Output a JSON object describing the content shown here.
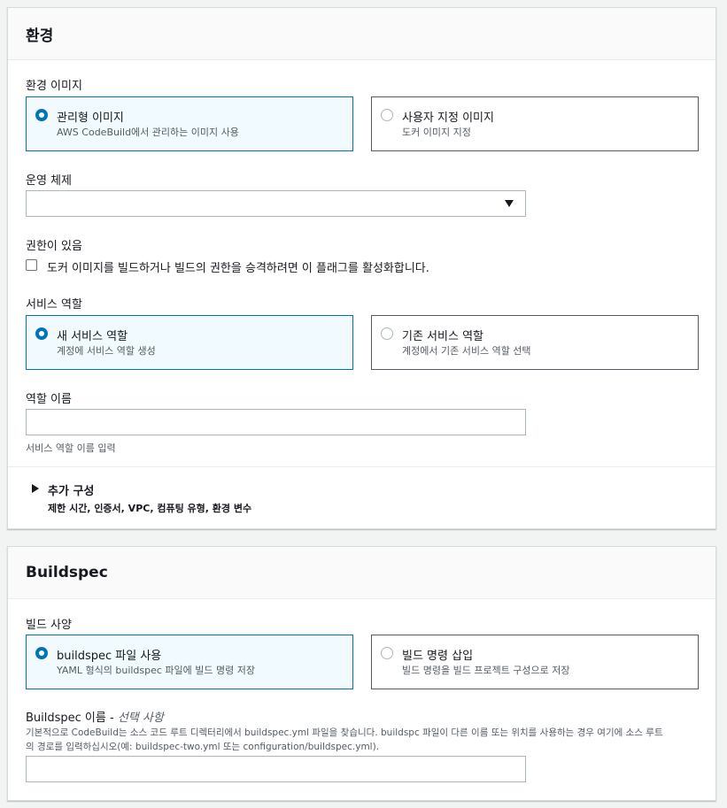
{
  "environment": {
    "title": "환경",
    "image_label": "환경 이미지",
    "image_options": [
      {
        "title": "관리형 이미지",
        "desc": "AWS CodeBuild에서 관리하는 이미지 사용",
        "selected": true
      },
      {
        "title": "사용자 지정 이미지",
        "desc": "도커 이미지 지정",
        "selected": false
      }
    ],
    "os_label": "운영 체제",
    "os_value": "",
    "privileged_label": "권한이 있음",
    "privileged_checkbox": "도커 이미지를 빌드하거나 빌드의 권한을 승격하려면 이 플래그를 활성화합니다.",
    "privileged_checked": false,
    "service_role_label": "서비스 역할",
    "service_role_options": [
      {
        "title": "새 서비스 역할",
        "desc": "계정에 서비스 역할 생성",
        "selected": true
      },
      {
        "title": "기존 서비스 역할",
        "desc": "계정에서 기존 서비스 역할 선택",
        "selected": false
      }
    ],
    "role_name_label": "역할 이름",
    "role_name_value": "",
    "role_name_hint": "서비스 역할 이름 입력",
    "additional_title": "추가 구성",
    "additional_desc": "제한 시간, 인증서, VPC, 컴퓨팅 유형, 환경 변수"
  },
  "buildspec": {
    "title": "Buildspec",
    "spec_label": "빌드 사양",
    "spec_options": [
      {
        "title": "buildspec 파일 사용",
        "desc": "YAML 형식의 buildspec 파일에 빌드 명령 저장",
        "selected": true
      },
      {
        "title": "빌드 명령 삽입",
        "desc": "빌드 명령을 빌드 프로젝트 구성으로 저장",
        "selected": false
      }
    ],
    "name_label": "Buildspec 이름",
    "name_optional": "선택 사항",
    "name_desc_line1": "기본적으로 CodeBuild는 소스 코드 루트 디렉터리에서 buildspec.yml 파일을 찾습니다. buildspc 파일이 다른 이름 또는 위치를 사용하는 경우 여기에 소스 루트",
    "name_desc_line2": "의 경로를 입력하십시오(예: buildspec-two.yml 또는 configuration/buildspec.yml).",
    "name_value": ""
  }
}
